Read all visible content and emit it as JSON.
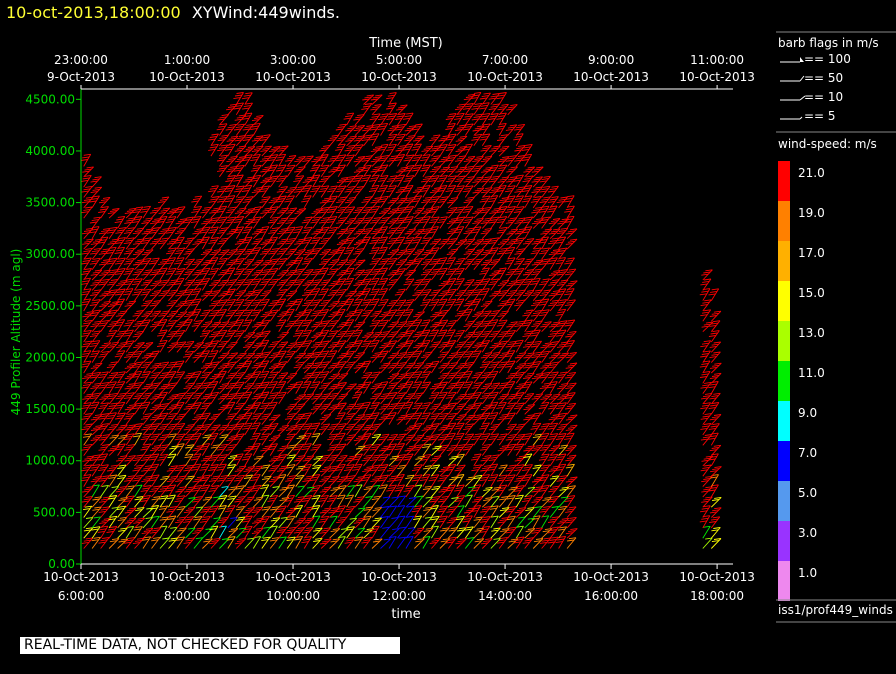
{
  "header": {
    "date_time": "10-oct-2013,18:00:00",
    "name": "XYWind:449winds."
  },
  "footer": {
    "quality_note": "REAL-TIME DATA, NOT CHECKED FOR QUALITY"
  },
  "legend": {
    "barb_title": "barb flags in m/s",
    "barbs": [
      "== 100",
      "== 50",
      "== 10",
      "== 5"
    ],
    "speed_title": "wind-speed: m/s",
    "speed_bins": [
      {
        "label": "21.0",
        "color": "#ff0000"
      },
      {
        "label": "19.0",
        "color": "#ff8000"
      },
      {
        "label": "17.0",
        "color": "#ffb000"
      },
      {
        "label": "15.0",
        "color": "#ffff00"
      },
      {
        "label": "13.0",
        "color": "#aaff00"
      },
      {
        "label": "11.0",
        "color": "#00ee00"
      },
      {
        "label": "9.0",
        "color": "#00ffff"
      },
      {
        "label": "7.0",
        "color": "#0000ff"
      },
      {
        "label": "5.0",
        "color": "#5599ee"
      },
      {
        "label": "3.0",
        "color": "#9933ff"
      },
      {
        "label": "1.0",
        "color": "#ee88ee"
      }
    ],
    "source": "iss1/prof449_winds"
  },
  "chart_data": {
    "type": "scatter",
    "title": "",
    "xlabel": "time",
    "x2label": "Time (MST)",
    "ylabel": "449 Profiler Altitude (m agl)",
    "ylim": [
      0,
      4600
    ],
    "xlim": [
      "10-Oct-2013 6:00:00",
      "10-Oct-2013 18:30:00"
    ],
    "yticks": [
      "0.00",
      "500.00",
      "1000.00",
      "1500.00",
      "2000.00",
      "2500.00",
      "3000.00",
      "3500.00",
      "4000.00",
      "4500.00"
    ],
    "xticks_bottom": [
      {
        "date": "10-Oct-2013",
        "time": "6:00:00"
      },
      {
        "date": "10-Oct-2013",
        "time": "8:00:00"
      },
      {
        "date": "10-Oct-2013",
        "time": "10:00:00"
      },
      {
        "date": "10-Oct-2013",
        "time": "12:00:00"
      },
      {
        "date": "10-Oct-2013",
        "time": "14:00:00"
      },
      {
        "date": "10-Oct-2013",
        "time": "16:00:00"
      },
      {
        "date": "10-Oct-2013",
        "time": "18:00:00"
      }
    ],
    "xticks_top": [
      {
        "time": "23:00:00",
        "date": "9-Oct-2013"
      },
      {
        "time": "1:00:00",
        "date": "10-Oct-2013"
      },
      {
        "time": "3:00:00",
        "date": "10-Oct-2013"
      },
      {
        "time": "5:00:00",
        "date": "10-Oct-2013"
      },
      {
        "time": "7:00:00",
        "date": "10-Oct-2013"
      },
      {
        "time": "9:00:00",
        "date": "10-Oct-2013"
      },
      {
        "time": "11:00:00",
        "date": "10-Oct-2013"
      }
    ],
    "profile_interval_minutes": 6,
    "gap_hours": [
      15.4,
      17.6
    ],
    "profile_top_altitude_m": [
      {
        "hour": 6.0,
        "top": 3900
      },
      {
        "hour": 6.5,
        "top": 3400
      },
      {
        "hour": 7.0,
        "top": 3350
      },
      {
        "hour": 7.5,
        "top": 3500
      },
      {
        "hour": 8.0,
        "top": 3300
      },
      {
        "hour": 8.5,
        "top": 4200
      },
      {
        "hour": 9.0,
        "top": 4550
      },
      {
        "hour": 9.5,
        "top": 4000
      },
      {
        "hour": 10.0,
        "top": 3900
      },
      {
        "hour": 10.5,
        "top": 3950
      },
      {
        "hour": 11.0,
        "top": 4300
      },
      {
        "hour": 11.5,
        "top": 4550
      },
      {
        "hour": 12.0,
        "top": 4400
      },
      {
        "hour": 12.5,
        "top": 4000
      },
      {
        "hour": 13.0,
        "top": 4400
      },
      {
        "hour": 13.5,
        "top": 4550
      },
      {
        "hour": 14.0,
        "top": 4450
      },
      {
        "hour": 14.5,
        "top": 3850
      },
      {
        "hour": 15.0,
        "top": 3500
      },
      {
        "hour": 15.3,
        "top": 3450
      },
      {
        "hour": 17.7,
        "top": 2900
      },
      {
        "hour": 18.0,
        "top": 2350
      }
    ]
  }
}
